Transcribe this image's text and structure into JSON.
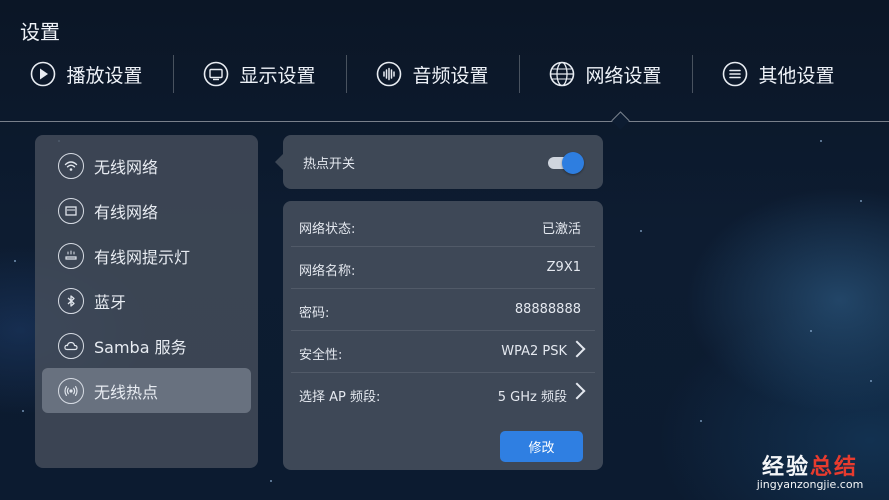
{
  "page": {
    "title": "设置"
  },
  "tabs": [
    {
      "label": "播放设置",
      "icon": "play-icon"
    },
    {
      "label": "显示设置",
      "icon": "monitor-icon"
    },
    {
      "label": "音频设置",
      "icon": "audio-wave-icon"
    },
    {
      "label": "网络设置",
      "icon": "globe-icon",
      "selected": true
    },
    {
      "label": "其他设置",
      "icon": "menu-list-icon"
    }
  ],
  "sidebar": {
    "items": [
      {
        "label": "无线网络",
        "icon": "wifi-icon"
      },
      {
        "label": "有线网络",
        "icon": "ethernet-icon"
      },
      {
        "label": "有线网提示灯",
        "icon": "indicator-light-icon"
      },
      {
        "label": "蓝牙",
        "icon": "bluetooth-icon"
      },
      {
        "label": "Samba 服务",
        "icon": "cloud-icon"
      },
      {
        "label": "无线热点",
        "icon": "hotspot-icon",
        "active": true
      }
    ]
  },
  "hotspot": {
    "label": "热点开关",
    "enabled": true
  },
  "details": {
    "rows": [
      {
        "key": "网络状态:",
        "value": "已激活"
      },
      {
        "key": "网络名称:",
        "value": "Z9X1"
      },
      {
        "key": "密码:",
        "value": "88888888"
      },
      {
        "key": "安全性:",
        "value": "WPA2 PSK",
        "arrow": true
      },
      {
        "key": "选择 AP 频段:",
        "value": "5 GHz 频段",
        "arrow": true
      }
    ],
    "edit_label": "修改"
  },
  "watermark": {
    "main_black": "经验",
    "main_red": "总结",
    "sub": "jingyanzongjie.com"
  },
  "colors": {
    "accent": "#2f7fe2",
    "watermark_red": "#e83b2e"
  }
}
